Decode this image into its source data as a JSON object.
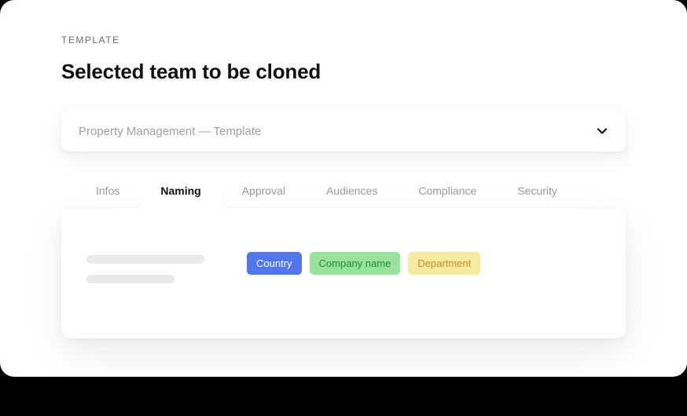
{
  "overline": "TEMPLATE",
  "title": "Selected team to be cloned",
  "select": {
    "value": "Property Management — Template"
  },
  "tabs": [
    {
      "label": "Infos",
      "active": false
    },
    {
      "label": "Naming",
      "active": true
    },
    {
      "label": "Approval",
      "active": false
    },
    {
      "label": "Audiences",
      "active": false
    },
    {
      "label": "Compliance",
      "active": false
    },
    {
      "label": "Security",
      "active": false
    }
  ],
  "tags": [
    {
      "label": "Country",
      "color": "blue"
    },
    {
      "label": "Company name",
      "color": "green"
    },
    {
      "label": "Department",
      "color": "yellow"
    }
  ]
}
